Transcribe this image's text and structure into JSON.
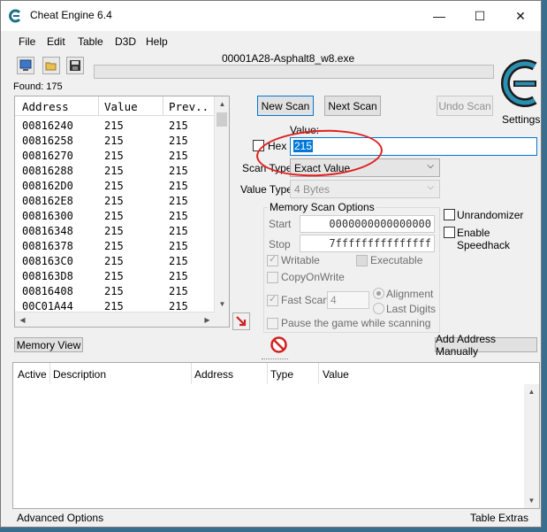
{
  "window": {
    "title": "Cheat Engine 6.4",
    "controls": {
      "minimize": "—",
      "maximize": "☐",
      "close": "✕"
    }
  },
  "menu": [
    "File",
    "Edit",
    "Table",
    "D3D",
    "Help"
  ],
  "process_name": "00001A28-Asphalt8_w8.exe",
  "found_label": "Found: 175",
  "settings_label": "Settings",
  "results": {
    "columns": [
      "Address",
      "Value",
      "Prev.."
    ],
    "rows": [
      [
        "00816240",
        "215",
        "215"
      ],
      [
        "00816258",
        "215",
        "215"
      ],
      [
        "00816270",
        "215",
        "215"
      ],
      [
        "00816288",
        "215",
        "215"
      ],
      [
        "008162D0",
        "215",
        "215"
      ],
      [
        "008162E8",
        "215",
        "215"
      ],
      [
        "00816300",
        "215",
        "215"
      ],
      [
        "00816348",
        "215",
        "215"
      ],
      [
        "00816378",
        "215",
        "215"
      ],
      [
        "008163C0",
        "215",
        "215"
      ],
      [
        "008163D8",
        "215",
        "215"
      ],
      [
        "00816408",
        "215",
        "215"
      ],
      [
        "00C01A44",
        "215",
        "215"
      ]
    ]
  },
  "buttons": {
    "new_scan": "New Scan",
    "next_scan": "Next Scan",
    "undo_scan": "Undo Scan",
    "memory_view": "Memory View",
    "add_address": "Add Address Manually"
  },
  "scan": {
    "value_label": "Value:",
    "hex_label": "Hex",
    "value": "215",
    "scan_type_label": "Scan Type",
    "scan_type": "Exact Value",
    "value_type_label": "Value Type",
    "value_type": "4 Bytes"
  },
  "memory_options": {
    "title": "Memory Scan Options",
    "start_label": "Start",
    "start": "0000000000000000",
    "stop_label": "Stop",
    "stop": "7fffffffffffffff",
    "writable": "Writable",
    "executable": "Executable",
    "copy_on_write": "CopyOnWrite",
    "fast_scan": "Fast Scan",
    "fast_scan_value": "4",
    "alignment": "Alignment",
    "last_digits": "Last Digits",
    "pause": "Pause the game while scanning"
  },
  "extra_options": {
    "unrandomizer": "Unrandomizer",
    "speedhack": "Enable Speedhack"
  },
  "address_list": {
    "columns": [
      "Active",
      "Description",
      "Address",
      "Type",
      "Value"
    ]
  },
  "status": {
    "advanced": "Advanced Options",
    "table_extras": "Table Extras"
  },
  "colors": {
    "accent": "#0078d7",
    "annotation": "#e02020"
  }
}
